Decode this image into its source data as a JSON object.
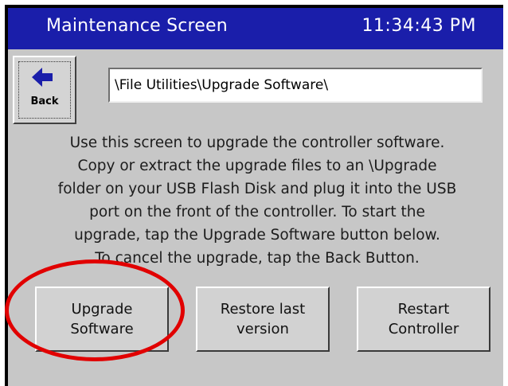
{
  "titlebar": {
    "title": "Maintenance Screen",
    "time": "11:34:43 PM",
    "color": "#1a1eaa"
  },
  "back_button": {
    "label": "Back",
    "icon": "left-arrow-icon"
  },
  "path": {
    "value": "\\File Utilities\\Upgrade Software\\"
  },
  "instructions": {
    "lines": [
      "Use this screen to upgrade the controller software.",
      "Copy or extract the upgrade files to an \\Upgrade",
      "folder on your USB Flash Disk and plug it into the USB",
      "port on the front of the controller. To start the",
      "upgrade, tap the Upgrade Software button below.",
      "To cancel the upgrade, tap the Back Button."
    ]
  },
  "buttons": {
    "upgrade": {
      "line1": "Upgrade",
      "line2": "Software"
    },
    "restore": {
      "line1": "Restore last",
      "line2": "version"
    },
    "restart": {
      "line1": "Restart",
      "line2": "Controller"
    }
  },
  "annotation": {
    "highlight_color": "#e10000"
  }
}
